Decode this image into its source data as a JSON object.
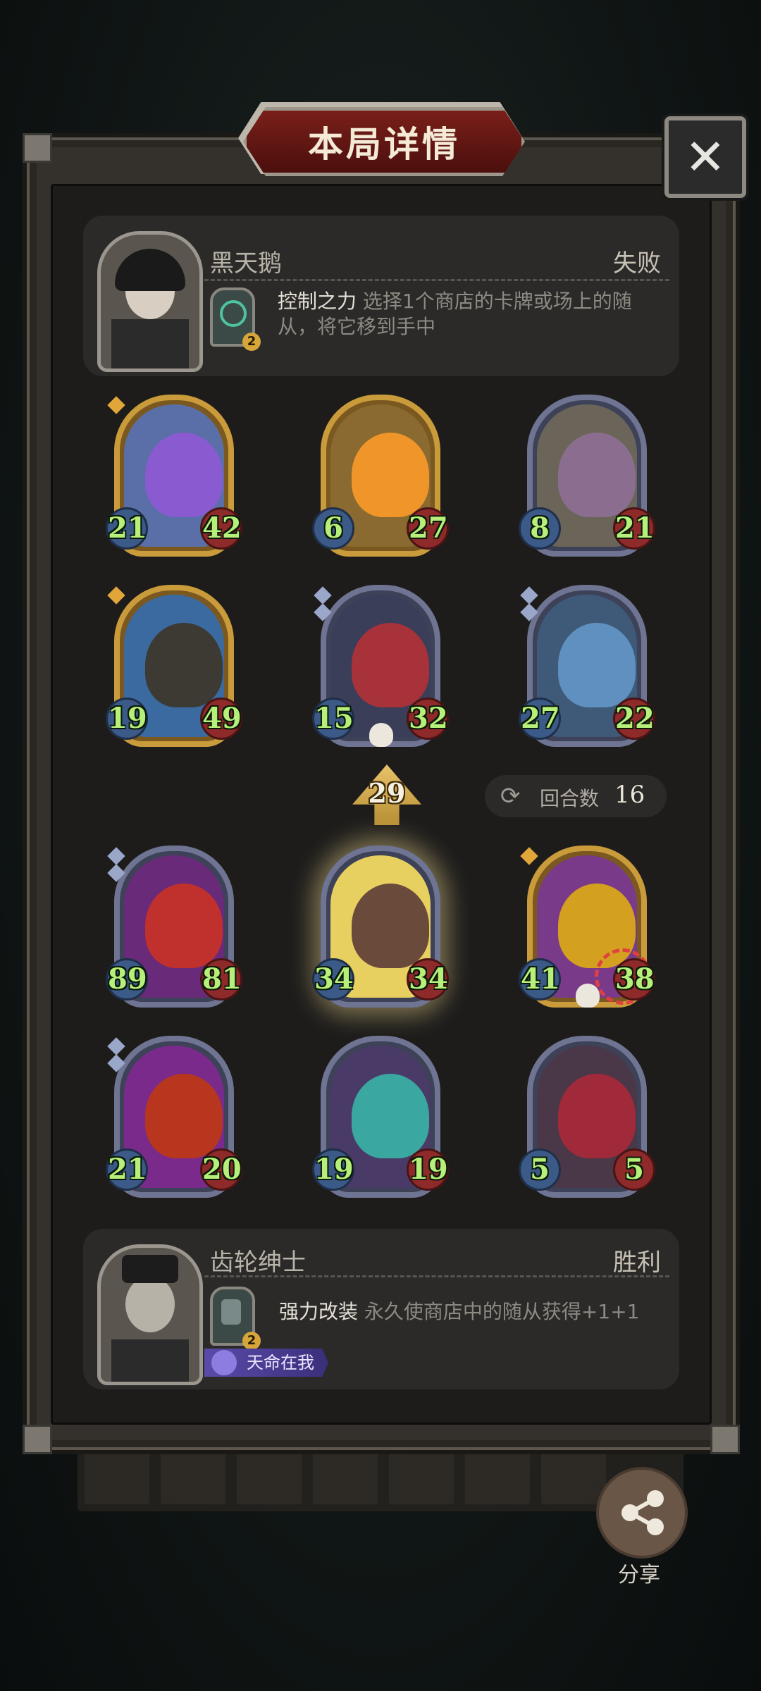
{
  "title": "本局详情",
  "close_label": "✕",
  "opponent": {
    "name": "黑天鹅",
    "result": "失败",
    "skill_name": "控制之力",
    "skill_desc_line1": " 选择1个商店的卡牌或场上的随",
    "skill_desc_line2": "从，将它移到手中",
    "skill_cost": "2"
  },
  "player": {
    "name": "齿轮绅士",
    "result": "胜利",
    "skill_name": "强力改装",
    "skill_desc": " 永久使商店中的随从获得+1+1",
    "skill_cost": "2",
    "badge": "天命在我"
  },
  "opponent_board": [
    {
      "atk": "21",
      "hp": "42"
    },
    {
      "atk": "6",
      "hp": "27"
    },
    {
      "atk": "8",
      "hp": "21"
    },
    {
      "atk": "19",
      "hp": "49"
    },
    {
      "atk": "15",
      "hp": "32"
    },
    {
      "atk": "27",
      "hp": "22"
    }
  ],
  "player_board": [
    {
      "atk": "89",
      "hp": "81"
    },
    {
      "atk": "34",
      "hp": "34"
    },
    {
      "atk": "41",
      "hp": "38"
    },
    {
      "atk": "21",
      "hp": "20"
    },
    {
      "atk": "19",
      "hp": "19"
    },
    {
      "atk": "5",
      "hp": "5"
    }
  ],
  "level": "29",
  "rounds": {
    "label": "回合数",
    "value": "16",
    "icon": "refresh-icon"
  },
  "share": {
    "label": "分享",
    "icon": "share-icon"
  },
  "colors": {
    "panel": "#34312c",
    "title_plate": "#7a1f1a",
    "stat_text": "#b6f07a",
    "gold_frame": "#c99b3a",
    "silver_frame": "#6e7491"
  }
}
